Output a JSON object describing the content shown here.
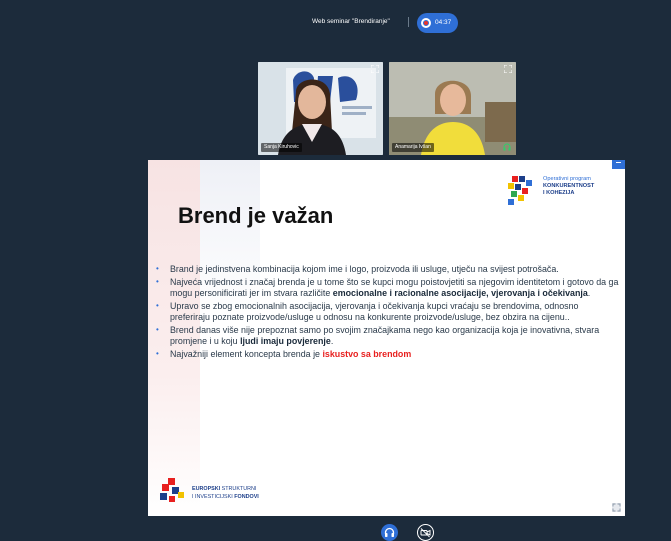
{
  "topbar": {
    "meeting_title": "Web seminar \"Brendiranje\"",
    "recording_time": "04:37"
  },
  "participants": [
    {
      "name": "Sanja Kiruhovic",
      "tile_bg": "#dfe7ec"
    },
    {
      "name": "Anamarija Ivšan",
      "tile_bg": "#bfc0b6"
    }
  ],
  "slide": {
    "title": "Brend je važan",
    "op_logo": {
      "line1": "Operativni program",
      "line2": "KONKURENTNOST",
      "line3": "I KOHEZIJA"
    },
    "bullets": [
      {
        "plain": "Brand je jedinstvena kombinacija kojom ime i logo, proizvoda ili usluge, utječu na svijest potrošača."
      },
      {
        "plain": "Najveća vrijednost i značaj brenda je u tome što se kupci mogu poistovjetiti sa njegovim identitetom i gotovo da ga mogu personificirati jer im stvara različite ",
        "bold": "emocionalne i racionalne asocijacije, vjerovanja i očekivanja",
        "after": "."
      },
      {
        "plain": "Upravo se zbog emocionalnih asocijacija, vjerovanja i očekivanja kupci vraćaju se brendovima, odnosno preferiraju poznate proizvode/usluge u odnosu na konkurente proizvode/usluge, bez obzira na cijenu.."
      },
      {
        "plain": "Brend danas više nije prepoznat samo po svojim značajkama nego kao organizacija koja je inovativna, stvara promjene i u koju ",
        "bold": "ljudi imaju povjerenje",
        "after": "."
      },
      {
        "plain": "Najvažniji element koncepta brenda je ",
        "red": "iskustvo sa brendom"
      }
    ],
    "eu_logo": {
      "line1_bold": "EUROPSKI",
      "line1_rest": " STRUKTURNI",
      "line2_rest": "I INVESTICIJSKI ",
      "line2_bold": "FONDOVI"
    }
  },
  "colors": {
    "background": "#1c2b3b",
    "accent": "#2f6fd6",
    "record_red": "#e8352c",
    "highlight_red": "#e8201f"
  },
  "icons": {
    "record": "record-icon",
    "expand": "expand-icon",
    "headphones": "headphones-icon",
    "camera_off": "camera-off-icon"
  }
}
